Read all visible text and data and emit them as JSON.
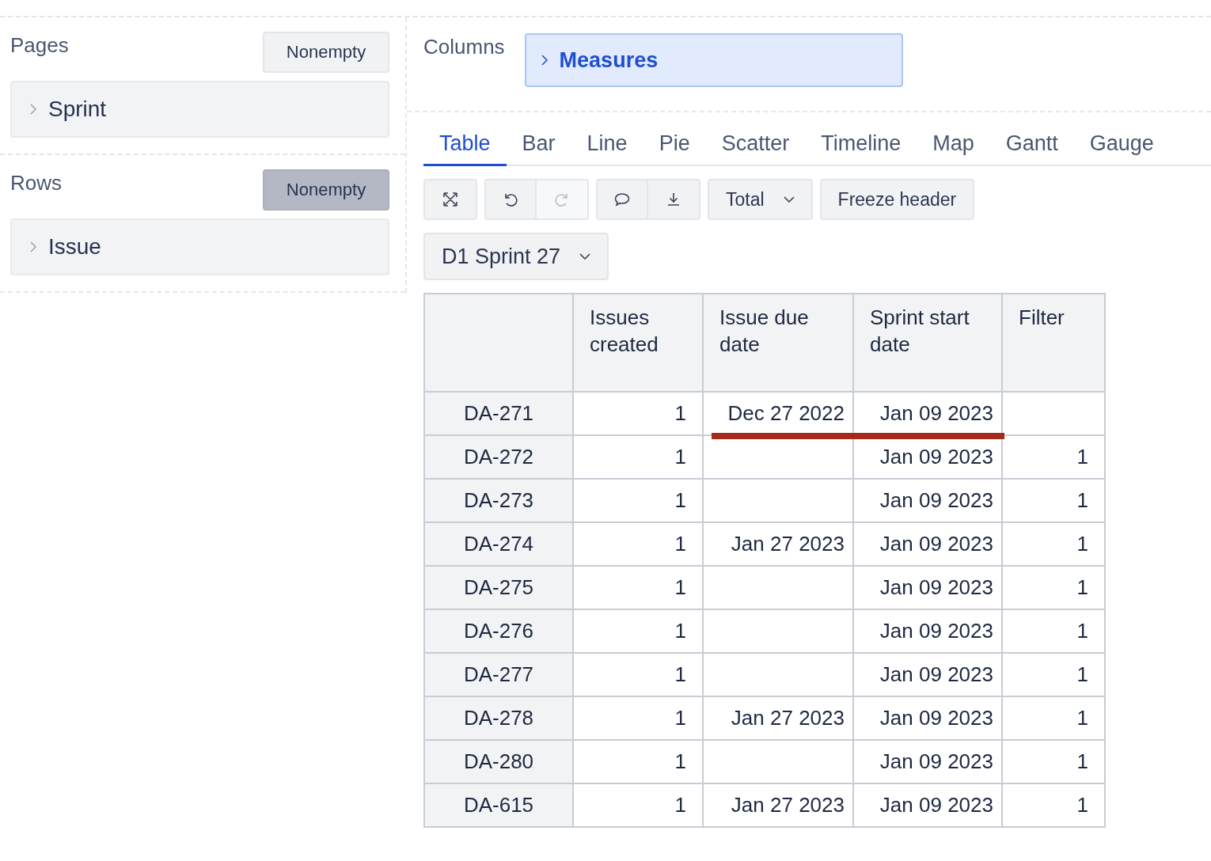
{
  "sections": [
    {
      "title": "Pages",
      "nonempty": {
        "label": "Nonempty",
        "active": false
      },
      "items": [
        {
          "label": "Sprint"
        }
      ]
    },
    {
      "title": "Rows",
      "nonempty": {
        "label": "Nonempty",
        "active": true
      },
      "items": [
        {
          "label": "Issue"
        }
      ]
    }
  ],
  "columns": {
    "title": "Columns",
    "items": [
      {
        "label": "Measures"
      }
    ]
  },
  "tabs": [
    {
      "label": "Table",
      "selected": true
    },
    {
      "label": "Bar",
      "selected": false
    },
    {
      "label": "Line",
      "selected": false
    },
    {
      "label": "Pie",
      "selected": false
    },
    {
      "label": "Scatter",
      "selected": false
    },
    {
      "label": "Timeline",
      "selected": false
    },
    {
      "label": "Map",
      "selected": false
    },
    {
      "label": "Gantt",
      "selected": false
    },
    {
      "label": "Gauge",
      "selected": false
    }
  ],
  "toolbar": {
    "redo_disabled": true,
    "total": "Total",
    "freeze": "Freeze header"
  },
  "page_filter": "D1 Sprint 27",
  "table": {
    "columns": [
      "Issues created",
      "Issue due date",
      "Sprint start date",
      "Filter"
    ],
    "rows": [
      {
        "name": "DA-271",
        "cells": [
          "1",
          "Dec 27 2022",
          "Jan 09 2023",
          ""
        ],
        "underlined": true
      },
      {
        "name": "DA-272",
        "cells": [
          "1",
          "",
          "Jan 09 2023",
          "1"
        ],
        "underlined": false
      },
      {
        "name": "DA-273",
        "cells": [
          "1",
          "",
          "Jan 09 2023",
          "1"
        ],
        "underlined": false
      },
      {
        "name": "DA-274",
        "cells": [
          "1",
          "Jan 27 2023",
          "Jan 09 2023",
          "1"
        ],
        "underlined": false
      },
      {
        "name": "DA-275",
        "cells": [
          "1",
          "",
          "Jan 09 2023",
          "1"
        ],
        "underlined": false
      },
      {
        "name": "DA-276",
        "cells": [
          "1",
          "",
          "Jan 09 2023",
          "1"
        ],
        "underlined": false
      },
      {
        "name": "DA-277",
        "cells": [
          "1",
          "",
          "Jan 09 2023",
          "1"
        ],
        "underlined": false
      },
      {
        "name": "DA-278",
        "cells": [
          "1",
          "Jan 27 2023",
          "Jan 09 2023",
          "1"
        ],
        "underlined": false
      },
      {
        "name": "DA-280",
        "cells": [
          "1",
          "",
          "Jan 09 2023",
          "1"
        ],
        "underlined": false
      },
      {
        "name": "DA-615",
        "cells": [
          "1",
          "Jan 27 2023",
          "Jan 09 2023",
          "1"
        ],
        "underlined": false
      }
    ]
  }
}
